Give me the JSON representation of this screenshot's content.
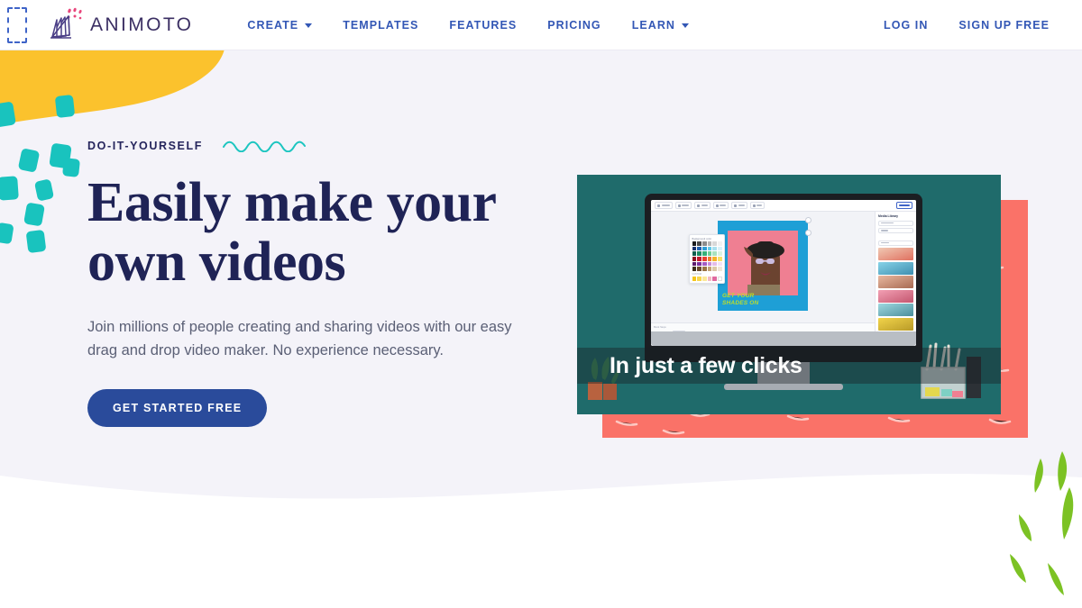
{
  "brand": {
    "name": "ANIMOTO",
    "logo_icon": "animoto-fan-logo",
    "mark_colors": [
      "#5b4b9b",
      "#3b3270",
      "#e8467c"
    ]
  },
  "header": {
    "nav": [
      {
        "label": "CREATE",
        "has_dropdown": true,
        "icon": "chevron-down-icon"
      },
      {
        "label": "TEMPLATES",
        "has_dropdown": false
      },
      {
        "label": "FEATURES",
        "has_dropdown": false
      },
      {
        "label": "PRICING",
        "has_dropdown": false
      },
      {
        "label": "LEARN",
        "has_dropdown": true,
        "icon": "chevron-down-icon"
      }
    ],
    "account": [
      {
        "label": "LOG IN"
      },
      {
        "label": "SIGN UP FREE"
      }
    ],
    "link_color": "#3357b5"
  },
  "hero": {
    "eyebrow": "DO-IT-YOURSELF",
    "squiggle_icon": "wavy-line-icon",
    "squiggle_color": "#1cc5c0",
    "headline_line1": "Easily make your",
    "headline_line2": "own videos",
    "headline_color": "#1f2356",
    "subcopy": "Join millions of people creating and sharing videos with our easy drag and drop video maker. No experience necessary.",
    "cta_label": "GET STARTED FREE",
    "cta_color": "#2a4b9b",
    "background_color": "#f4f3f9"
  },
  "decor": {
    "yellow_blob_color": "#fbc22d",
    "teal_confetti_color": "#19c3be",
    "mint_circle_color": "#cfe6dd",
    "green_stroke_color": "#7cc224",
    "coral_block_color": "#fa7268",
    "skip_focus_ring": "skip-to-content-focus-ring"
  },
  "media": {
    "caption": "In just a few clicks",
    "video_background_color": "#1f6b6b",
    "editor": {
      "toolbar_items": [
        "Sections",
        "Design",
        "Music",
        "Stats",
        "Undo",
        "Redo"
      ],
      "export_label": "Export",
      "background_label": "Background",
      "palette_title": "Background color",
      "palette_sub_label": "CUSTOM",
      "palette_swatches": [
        "#1c1c1c",
        "#4a4a4a",
        "#8c8c8c",
        "#b5b5b5",
        "#d8d8d8",
        "#f2f2f2",
        "#16306b",
        "#1f5fb0",
        "#2e9ed6",
        "#63c9e8",
        "#a9e0ef",
        "#d9f1f8",
        "#0f5e4e",
        "#1d8a63",
        "#35b07a",
        "#6fcf97",
        "#a8e2bf",
        "#d9f2e3",
        "#8a1020",
        "#c4192c",
        "#e8412f",
        "#f07a2e",
        "#f5b32a",
        "#f7df6a",
        "#5b1a6b",
        "#7b2f9b",
        "#a35bc4",
        "#c98ad8",
        "#e3bce9",
        "#f3e2f6",
        "#3c2c1a",
        "#6b4a2a",
        "#9b7245",
        "#c2a173",
        "#ddc9a8",
        "#f0e6d6"
      ],
      "custom_swatches": [
        "#f5c518",
        "#f7d64c",
        "#fbe89a",
        "#f2b9c4",
        "#e06aa0",
        "#ffffff"
      ],
      "right_panel_title": "Media Library",
      "right_panel_fields": [
        "Add a photo or video",
        "License",
        "Media Type",
        "Photos"
      ],
      "thumbnails": [
        "#3fb4d4",
        "#d98a6a",
        "#e06a8a",
        "#4ea2b8",
        "#f0c03a"
      ],
      "timeline_label": "Block Steps",
      "timeline_time": "0:06",
      "slide": {
        "background": "#1e9fd6",
        "photo_background": "#ef7f92",
        "caption_line1": "GET YOUR",
        "caption_line2": "SHADES ON",
        "caption_color": "#bddd2a"
      }
    }
  }
}
